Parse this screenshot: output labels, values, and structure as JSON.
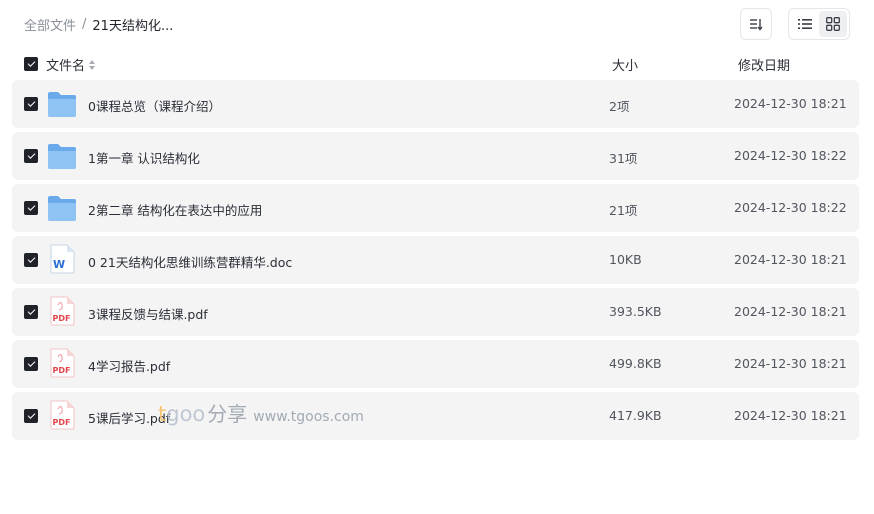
{
  "breadcrumb": {
    "root": "全部文件",
    "separator": "/",
    "current": "21天结构化..."
  },
  "toolbar": {
    "sort_icon": "sort-icon",
    "views": [
      {
        "name": "list-view",
        "icon": "list-icon",
        "active": false
      },
      {
        "name": "grid-view",
        "icon": "grid-icon",
        "active": true
      }
    ]
  },
  "table": {
    "headers": {
      "name": "文件名",
      "size": "大小",
      "modified": "修改日期"
    },
    "all_selected": true,
    "rows": [
      {
        "icon": "folder-icon",
        "name": "0课程总览（课程介绍）",
        "size": "2项",
        "date": "2024-12-30 18:21",
        "checked": true
      },
      {
        "icon": "folder-icon",
        "name": "1第一章 认识结构化",
        "size": "31项",
        "date": "2024-12-30 18:22",
        "checked": true
      },
      {
        "icon": "folder-icon",
        "name": "2第二章 结构化在表达中的应用",
        "size": "21项",
        "date": "2024-12-30 18:22",
        "checked": true
      },
      {
        "icon": "word-doc-icon",
        "name": "0 21天结构化思维训练营群精华.doc",
        "size": "10KB",
        "date": "2024-12-30 18:21",
        "checked": true
      },
      {
        "icon": "pdf-icon",
        "name": "3课程反馈与结课.pdf",
        "size": "393.5KB",
        "date": "2024-12-30 18:21",
        "checked": true
      },
      {
        "icon": "pdf-icon",
        "name": "4学习报告.pdf",
        "size": "499.8KB",
        "date": "2024-12-30 18:21",
        "checked": true
      },
      {
        "icon": "pdf-icon",
        "name": "5课后学习.pdf",
        "size": "417.9KB",
        "date": "2024-12-30 18:21",
        "checked": true
      }
    ]
  },
  "icon_labels": {
    "word": "W",
    "pdf": "PDF"
  },
  "watermark": {
    "t": "t",
    "goo": "goo",
    "share": "分享",
    "url": "www.tgoos.com"
  },
  "colors": {
    "row_bg": "#f4f4f5",
    "checkbox": "#1f2329",
    "folder": "#7fb6ee",
    "pdf": "#e0464b",
    "word": "#2b6fd6"
  }
}
